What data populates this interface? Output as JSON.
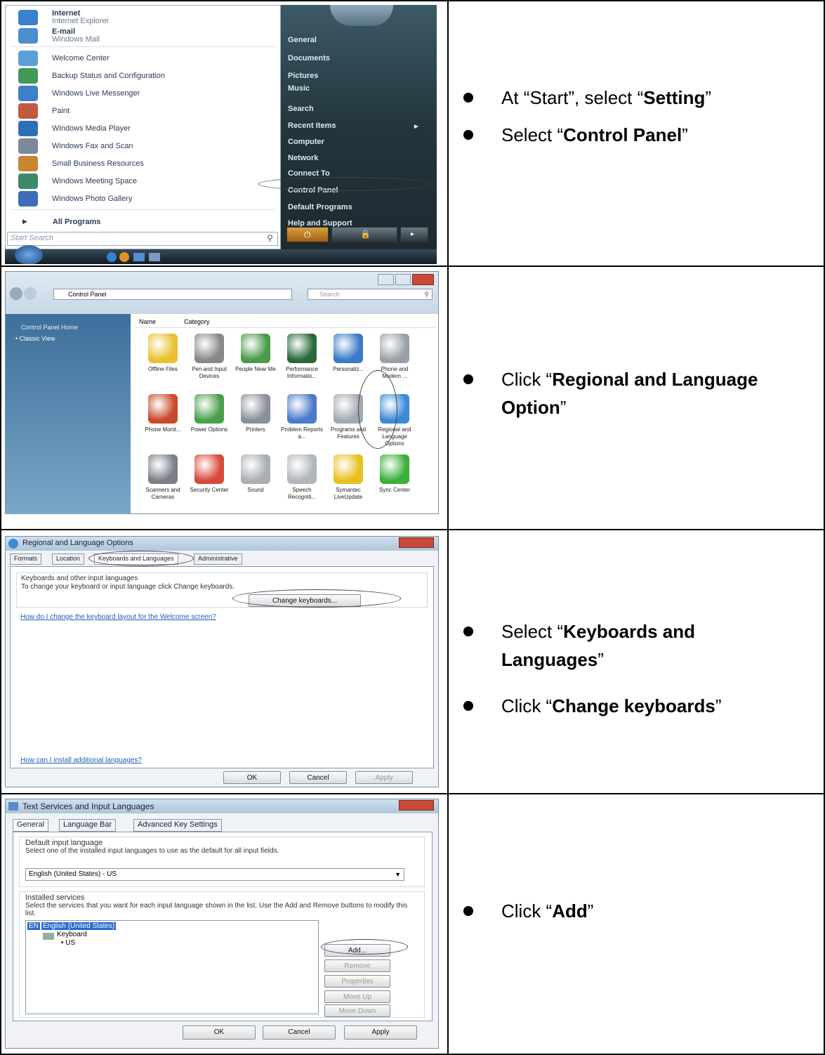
{
  "rows": [
    {
      "b1_pre": "At “Start”, select “",
      "b1_bold": "Setting",
      "b1_post": "”",
      "b2_pre": "Select “",
      "b2_bold": "Control Panel",
      "b2_post": "”"
    },
    {
      "b1_pre": "Click “",
      "b1_bold": "Regional and Language Option",
      "b1_post": "”"
    },
    {
      "b1_pre": "Select “",
      "b1_bold": "Keyboards and Languages",
      "b1_post": "”",
      "b2_pre": "Click “",
      "b2_bold": "Change keyboards",
      "b2_post": "”"
    },
    {
      "b1_pre": "Click “",
      "b1_bold": "Add",
      "b1_post": "”"
    }
  ],
  "start_menu": {
    "left_items": [
      {
        "title": "Internet",
        "sub": "Internet Explorer",
        "color": "#3a7fd0"
      },
      {
        "title": "E-mail",
        "sub": "Windows Mail",
        "color": "#4b8fcf"
      },
      {
        "label": "Welcome Center",
        "color": "#5aa0d8"
      },
      {
        "label": "Backup Status and Configuration",
        "color": "#3f9a5a"
      },
      {
        "label": "Windows Live Messenger",
        "color": "#3d7fc8"
      },
      {
        "label": "Paint",
        "color": "#c05a40"
      },
      {
        "label": "Windows Media Player",
        "color": "#2f6fb8"
      },
      {
        "label": "Windows Fax and Scan",
        "color": "#7a8a9a"
      },
      {
        "label": "Small Business Resources",
        "color": "#c7862f"
      },
      {
        "label": "Windows Meeting Space",
        "color": "#3d8a6a"
      },
      {
        "label": "Windows Photo Gallery",
        "color": "#3d6fb8"
      },
      {
        "label": "All Programs",
        "color": "#ffffff"
      }
    ],
    "search": "Start Search",
    "right_items": [
      "General",
      "Documents",
      "Pictures",
      "Music",
      "Search",
      "Recent Items",
      "Computer",
      "Network",
      "Connect To",
      "Control Panel",
      "Default Programs",
      "Help and Support"
    ]
  },
  "control_panel": {
    "address": "Control Panel",
    "search": "Search",
    "side_home": "Control Panel Home",
    "side_classic": "Classic View",
    "col_name": "Name",
    "col_category": "Category",
    "icons": [
      {
        "label": "Offline Files",
        "color": "#e8c030"
      },
      {
        "label": "Pen and Input Devices",
        "color": "#888888"
      },
      {
        "label": "People Near Me",
        "color": "#4a9a4a"
      },
      {
        "label": "Performance Informatio...",
        "color": "#2a6a3a"
      },
      {
        "label": "Personaliz...",
        "color": "#3a7ac8"
      },
      {
        "label": "Phone and Modem ...",
        "color": "#9aa0a8"
      },
      {
        "label": "Phone Monit...",
        "color": "#c84a2a"
      },
      {
        "label": "Power Options",
        "color": "#4aa04a"
      },
      {
        "label": "Printers",
        "color": "#8a9098"
      },
      {
        "label": "Problem Reports a...",
        "color": "#4a7ac8"
      },
      {
        "label": "Programs and Features",
        "color": "#a0a8b0"
      },
      {
        "label": "Regional and Language Options",
        "color": "#3a8ad8"
      },
      {
        "label": "Scanners and Cameras",
        "color": "#7a8088"
      },
      {
        "label": "Security Center",
        "color": "#d84a3a"
      },
      {
        "label": "Sound",
        "color": "#a8aeb4"
      },
      {
        "label": "Speech Recogniti...",
        "color": "#b0b6bc"
      },
      {
        "label": "Symantec LiveUpdate",
        "color": "#e8c020"
      },
      {
        "label": "Sync Center",
        "color": "#3ab03a"
      }
    ]
  },
  "regional": {
    "title": "Regional and Language Options",
    "tabs": [
      "Formats",
      "Location",
      "Keyboards and Languages",
      "Administrative"
    ],
    "group_title": "Keyboards and other input languages",
    "group_text": "To change your keyboard or input language click Change keyboards.",
    "change_btn": "Change keyboards...",
    "link1": "How do I change the keyboard layout for the Welcome screen?",
    "link2": "How can I install additional languages?",
    "ok": "OK",
    "cancel": "Cancel",
    "apply": "Apply"
  },
  "text_services": {
    "title": "Text Services and Input Languages",
    "tabs": [
      "General",
      "Language Bar",
      "Advanced Key Settings"
    ],
    "default_title": "Default input language",
    "default_text": "Select one of the installed input languages to use as the default for all input fields.",
    "default_value": "English (United States) - US",
    "installed_title": "Installed services",
    "installed_text": "Select the services that you want for each input language shown in the list. Use the Add and Remove buttons to modify this list.",
    "tree_lang_code": "EN",
    "tree_lang": "English (United States)",
    "tree_keyboard": "Keyboard",
    "tree_us": "• US",
    "buttons": [
      "Add...",
      "Remove",
      "Properties",
      "Move Up",
      "Move Down"
    ],
    "ok": "OK",
    "cancel": "Cancel",
    "apply": "Apply"
  }
}
